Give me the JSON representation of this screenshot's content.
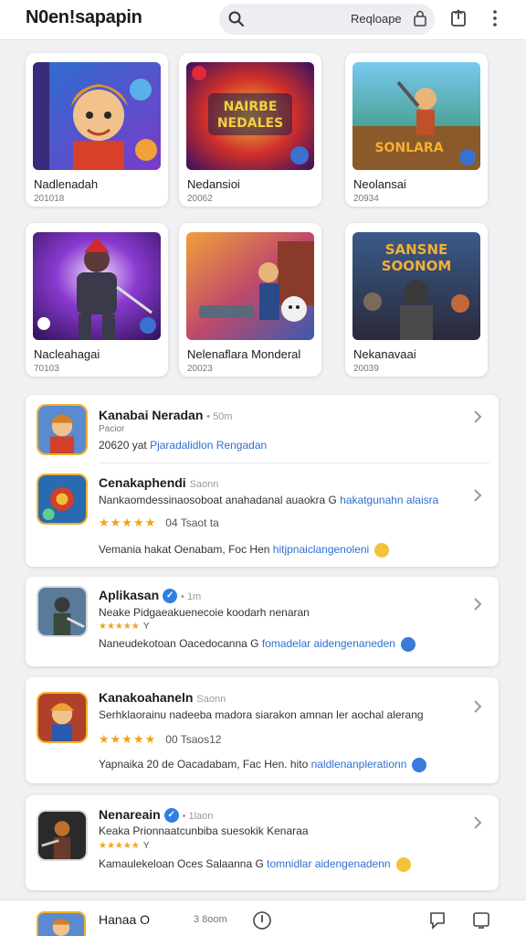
{
  "app_title": "N0en!sapapin",
  "search": {
    "value": "Reqloape"
  },
  "grid": [
    {
      "title": "Nadlenadah",
      "sub": "201018"
    },
    {
      "title": "Nedansioi",
      "sub": "20062"
    },
    {
      "title": "Neolansai",
      "sub": "20934"
    },
    {
      "title": "Nacleahagai",
      "sub": "70103"
    },
    {
      "title": "Nelenaflara Monderal",
      "sub": "20023"
    },
    {
      "title": "Nekanavaai",
      "sub": "20039"
    }
  ],
  "thumb_text": {
    "t2_line1": "NAIRBE",
    "t2_line2": "NEDALES",
    "t3": "SONLARA",
    "t6_line1": "SANSNE",
    "t6_line2": "SOONOM"
  },
  "list": [
    {
      "name": "Kanabai Neradan",
      "meta": "• 50m",
      "line1": "Pacior",
      "line2_prefix": "20620 yat",
      "line2_link": "Pjaradalidlon Rengadan"
    },
    {
      "name": "Cenakaphendi",
      "meta": "Saonn",
      "line1": "Nankaomdessinaosoboat anahadanal auaokra G",
      "line1_link": "hakatgunahn alaisra",
      "rating": "★★★★★",
      "count": "04 Tsaot ta",
      "line3": "Vemania hakat Oenabam, Foc Hen",
      "line3_link": "hitjpnaiclangenoleni"
    },
    {
      "name": "Aplikasan",
      "meta": "• 1m",
      "line1": "Neake Pidgaeakuenecoie koodarh nenaran",
      "rating": "★★★★★",
      "count": "Y",
      "line3": "Naneudekotoan Oacedocanna G",
      "line3_link": "fomadelar aidengenaneden"
    },
    {
      "name": "Kanakoahaneln",
      "meta": "Saonn",
      "line1": "Serhklaorainu nadeeba madora siarakon amnan ler aochal alerang",
      "rating": "★★★★★",
      "count": "00 Tsaos12",
      "line3": "Yapnaika 20 de Oacadabam, Fac Hen. hito",
      "line3_link": "naldlenanplerationn"
    },
    {
      "name": "Nenareain",
      "meta": "• 1laon",
      "line1": "Keaka Prionnaatcunbiba suesokik Kenaraa",
      "rating": "★★★★★",
      "count": "Y",
      "line3": "Kamaulekeloan Oces Salaanna G",
      "line3_link": "tomnidlar aidengenadenn"
    }
  ],
  "bottom": {
    "title": "Hanaa O",
    "meta": "3 8oom"
  },
  "colors": {
    "accent": "#2f6fd0",
    "star": "#f2a219",
    "icon_border": "#f0b22a"
  },
  "icons": [
    "search-icon",
    "lock-icon",
    "share-icon",
    "more-icon",
    "chevron-right-icon",
    "verified-badge-icon",
    "emoji-icon",
    "compass-icon",
    "bookmark-icon",
    "square-icon"
  ]
}
